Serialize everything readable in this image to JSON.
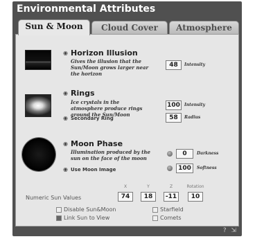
{
  "window": {
    "title": "Environmental Attributes"
  },
  "tabs": [
    {
      "label": "Sun & Moon",
      "active": true
    },
    {
      "label": "Cloud Cover",
      "active": false
    },
    {
      "label": "Atmosphere",
      "active": false
    }
  ],
  "sections": {
    "horizon": {
      "title": "Horizon Illusion",
      "desc": "Gives the illusion that the Sun/Moon grows larger near the horizon",
      "intensity_value": "48",
      "intensity_label": "Intensity"
    },
    "rings": {
      "title": "Rings",
      "desc": "Ice crystals in the atmosphere produce rings around the Sun/Moon",
      "intensity_value": "100",
      "intensity_label": "Intensity",
      "radius_value": "58",
      "radius_label": "Radius",
      "secondary_label": "Secondary Ring"
    },
    "moon_phase": {
      "title": "Moon Phase",
      "desc": "Illumination produced by the sun on the face of the moon",
      "darkness_value": "0",
      "darkness_label": "Darkness",
      "softness_value": "100",
      "softness_label": "Softness",
      "use_moon_image_label": "Use Moon Image"
    }
  },
  "numeric_sun": {
    "label": "Numeric Sun Values",
    "x_label": "X",
    "x_value": "74",
    "y_label": "Y",
    "y_value": "18",
    "z_label": "Z",
    "z_value": "-11",
    "rotation_label": "Rotation",
    "rotation_value": "10"
  },
  "options": {
    "disable_sunmoon": "Disable Sun&Moon",
    "link_sun_to_view": "Link Sun to View",
    "starfield": "Starfield",
    "comets": "Comets"
  },
  "footer": {
    "text": "?  ⇲"
  }
}
